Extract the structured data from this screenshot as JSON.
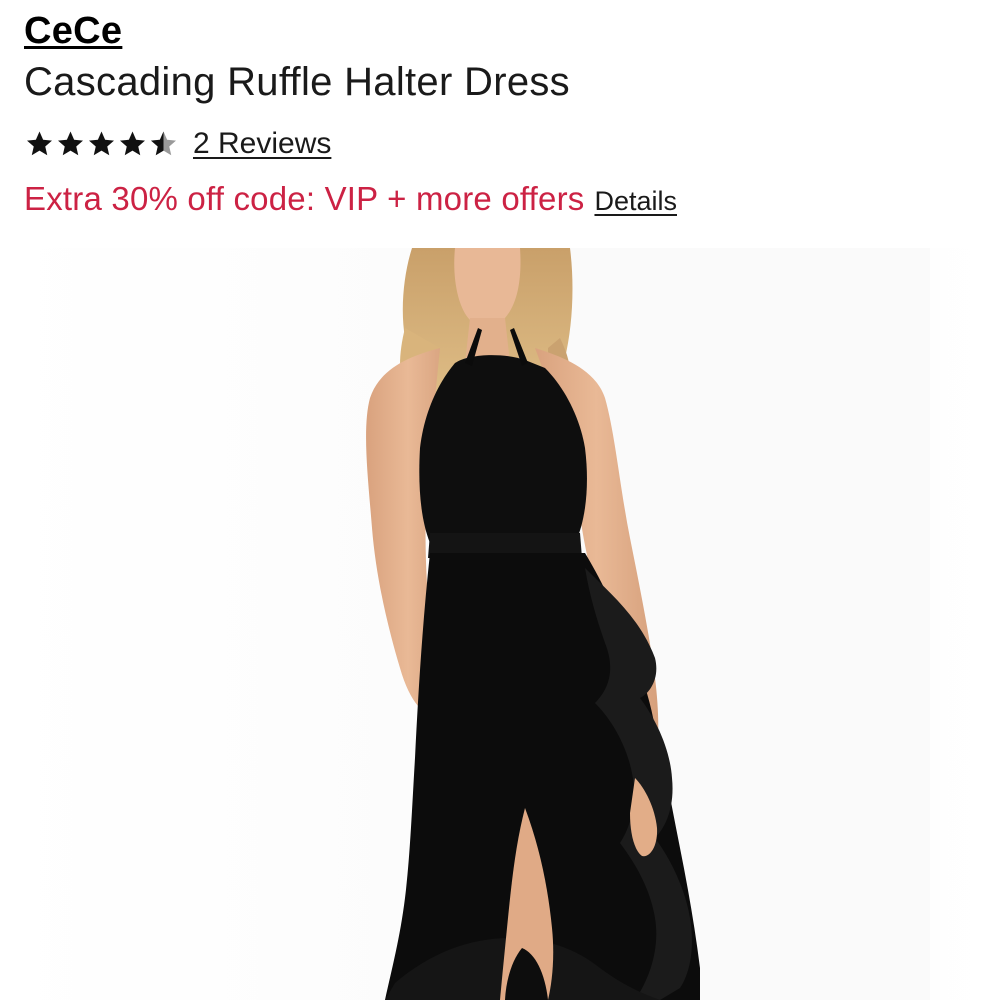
{
  "product": {
    "brand": "CeCe",
    "name": "Cascading Ruffle Halter Dress",
    "rating": 4.5,
    "rating_max": 5,
    "reviews_label": "2 Reviews",
    "offer_text": "Extra 30% off code: VIP + more offers",
    "details_label": "Details",
    "image_icon": "product-photo-black-halter-dress"
  },
  "colors": {
    "offer": "#cc2244",
    "star_filled": "#111111",
    "star_empty": "#9a9a9a"
  }
}
